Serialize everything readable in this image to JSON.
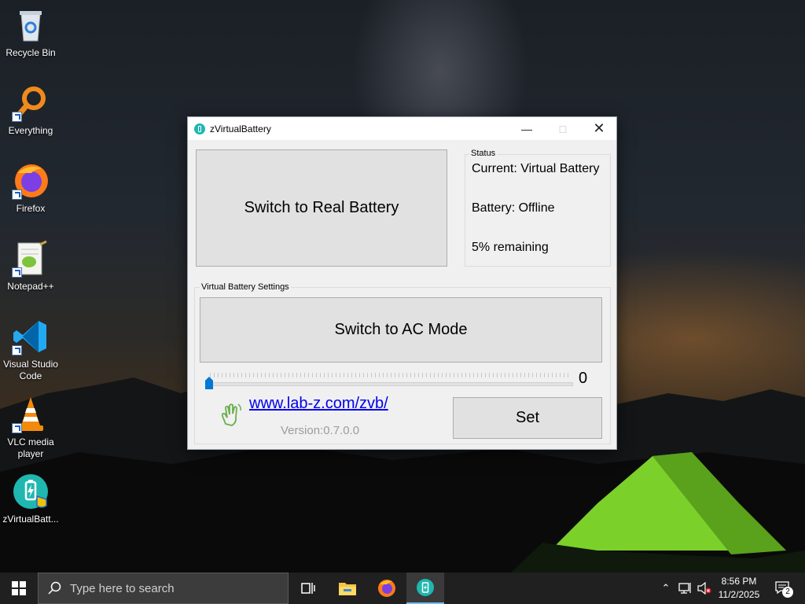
{
  "desktop": {
    "icons": [
      {
        "label": "Recycle Bin",
        "icon": "recycle-bin-icon"
      },
      {
        "label": "Everything",
        "icon": "everything-search-icon"
      },
      {
        "label": "Firefox",
        "icon": "firefox-icon"
      },
      {
        "label": "Notepad++",
        "icon": "notepad-plus-plus-icon"
      },
      {
        "label": "Visual Studio Code",
        "icon": "vscode-icon"
      },
      {
        "label": "VLC media player",
        "icon": "vlc-icon"
      },
      {
        "label": "zVirtualBatt...",
        "icon": "zvirtualbattery-icon"
      }
    ]
  },
  "window": {
    "title": "zVirtualBattery",
    "switch_battery_label": "Switch to Real Battery",
    "status": {
      "group_label": "Status",
      "current": "Current: Virtual Battery",
      "battery": "Battery: Offline",
      "remaining": "5% remaining"
    },
    "settings": {
      "group_label": "Virtual Battery Settings",
      "switch_mode_label": "Switch to AC Mode",
      "slider_value": "0",
      "link": "www.lab-z.com/zvb/",
      "version": "Version:0.7.0.0",
      "set_label": "Set"
    }
  },
  "taskbar": {
    "search_placeholder": "Type here to search",
    "apps": [
      "task-view-icon",
      "file-explorer-icon",
      "firefox-icon",
      "zvirtualbattery-icon"
    ],
    "active_app": "zvirtualbattery",
    "time": "8:56 PM",
    "date": "11/2/2025",
    "notification_count": "2"
  },
  "colors": {
    "accent": "#0078d7",
    "app_teal": "#1fb7b0",
    "link": "#0000ee",
    "taskbar": "#202020"
  }
}
